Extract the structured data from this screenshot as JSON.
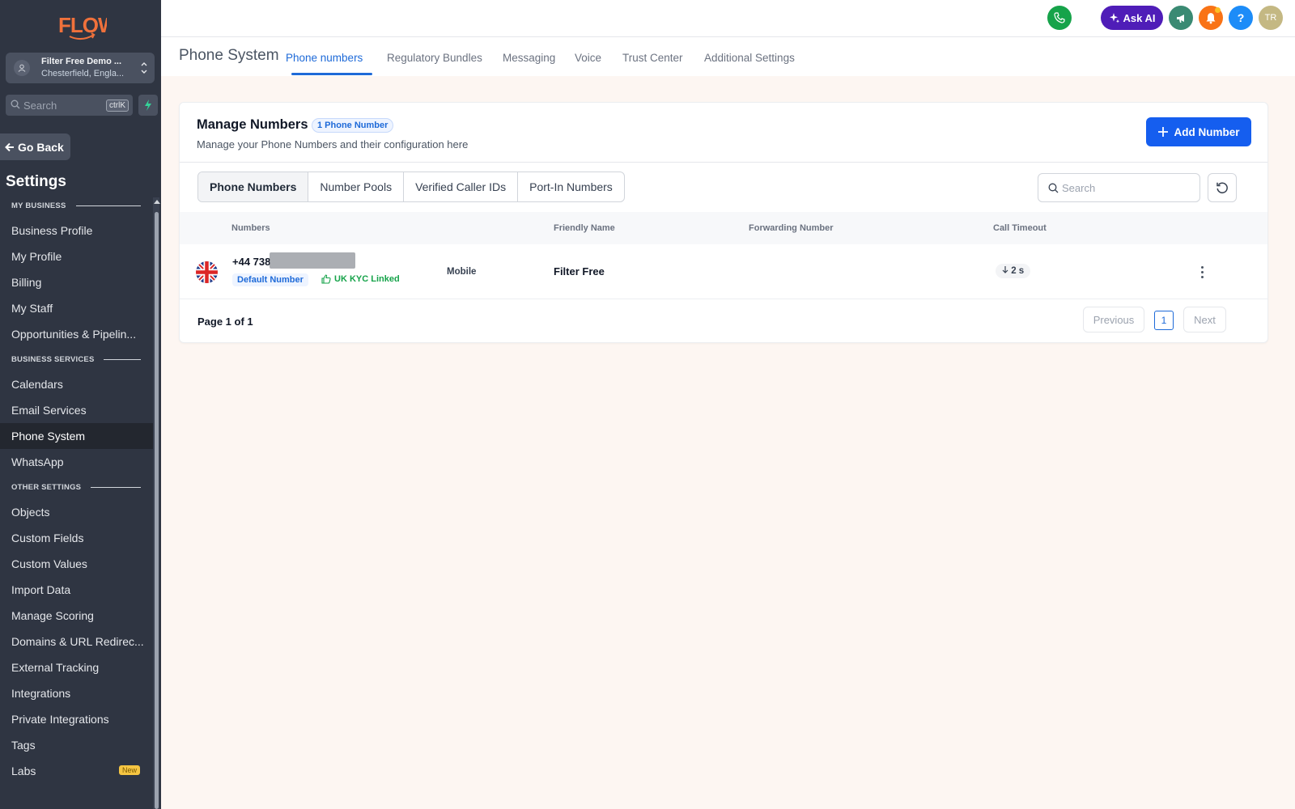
{
  "sidebar": {
    "logo_text": "FLOW",
    "account": {
      "name": "Filter Free Demo ...",
      "location": "Chesterfield, Engla..."
    },
    "search": {
      "placeholder": "Search",
      "shortcut": "ctrlK"
    },
    "go_back_label": "Go Back",
    "settings_title": "Settings",
    "sections": {
      "my_business": "MY BUSINESS",
      "business_services": "BUSINESS SERVICES",
      "other_settings": "OTHER SETTINGS"
    },
    "items": [
      "Business Profile",
      "My Profile",
      "Billing",
      "My Staff",
      "Opportunities & Pipelin...",
      "Calendars",
      "Email Services",
      "Phone System",
      "WhatsApp",
      "Objects",
      "Custom Fields",
      "Custom Values",
      "Import Data",
      "Manage Scoring",
      "Domains & URL Redirec...",
      "External Tracking",
      "Integrations",
      "Private Integrations",
      "Tags",
      "Labs"
    ],
    "active_item": "Phone System",
    "labs_badge": "New"
  },
  "topbar": {
    "ask_ai_label": "Ask AI",
    "user_initials": "TR",
    "icons": [
      "phone-icon",
      "sparkle-icon",
      "megaphone-icon",
      "bell-icon",
      "help-icon"
    ],
    "colors": {
      "phone": "#16a34a",
      "ask_ai": "#4f1db8",
      "megaphone": "#3a8a73",
      "bell": "#f97316",
      "help": "#1d8cf8",
      "avatar": "#c4b883"
    }
  },
  "page": {
    "title": "Phone System",
    "tabs": [
      "Phone numbers",
      "Regulatory Bundles",
      "Messaging",
      "Voice",
      "Trust Center",
      "Additional Settings"
    ],
    "active_tab": "Phone numbers"
  },
  "card": {
    "title": "Manage Numbers",
    "count_badge": "1 Phone Number",
    "subtitle": "Manage your Phone Numbers and their configuration here",
    "add_button": "Add Number",
    "segments": [
      "Phone Numbers",
      "Number Pools",
      "Verified Caller IDs",
      "Port-In Numbers"
    ],
    "active_segment": "Phone Numbers",
    "search_placeholder": "Search",
    "columns": {
      "numbers": "Numbers",
      "friendly_name": "Friendly Name",
      "forwarding_number": "Forwarding Number",
      "call_timeout": "Call Timeout"
    },
    "rows": [
      {
        "number": "+44 738",
        "default_badge": "Default Number",
        "kyc_label": "UK KYC Linked",
        "type": "Mobile",
        "friendly_name": "Filter Free",
        "forwarding_number": "",
        "call_timeout": "2 s"
      }
    ],
    "pager": {
      "text": "Page 1 of 1",
      "previous": "Previous",
      "page": "1",
      "next": "Next"
    }
  }
}
